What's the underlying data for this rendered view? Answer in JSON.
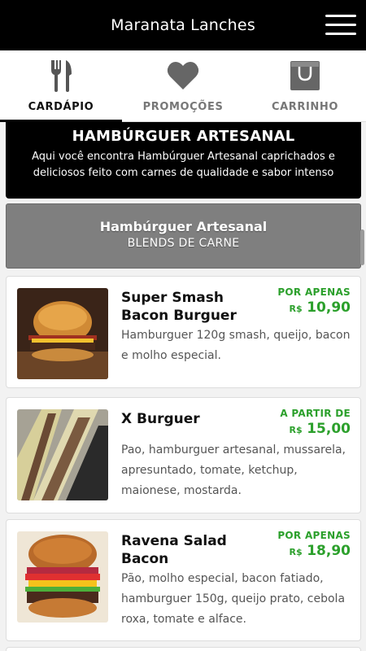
{
  "header": {
    "title": "Maranata Lanches",
    "menu_icon": "hamburger-menu-icon"
  },
  "tabs": [
    {
      "label": "CARDÁPIO",
      "icon": "fork-knife-icon",
      "active": true
    },
    {
      "label": "PROMOÇÕES",
      "icon": "heart-icon",
      "active": false
    },
    {
      "label": "CARRINHO",
      "icon": "shopping-bag-icon",
      "active": false
    }
  ],
  "category": {
    "title": "HAMBÚRGUER ARTESANAL",
    "description": "Aqui você encontra Hambúrguer Artesanal caprichados e deliciosos feito com carnes de qualidade e sabor intenso"
  },
  "section": {
    "title": "Hambúrguer Artesanal",
    "subtitle": "BLENDS DE CARNE"
  },
  "products": [
    {
      "name": "Super Smash Bacon Burguer",
      "price_prefix": "POR APENAS",
      "currency": "R$",
      "price": "10,90",
      "description": "Hamburguer 120g smash, queijo, bacon e molho especial."
    },
    {
      "name": "X Burguer",
      "price_prefix": "A PARTIR DE",
      "currency": "R$",
      "price": "15,00",
      "description": "Pao, hamburguer artesanal, mussarela, apresuntado, tomate, ketchup, maionese, mostarda."
    },
    {
      "name": "Ravena Salad Bacon",
      "price_prefix": "POR APENAS",
      "currency": "R$",
      "price": "18,90",
      "description": "Pão, molho especial, bacon fatiado, hamburguer 150g, queijo prato, cebola roxa, tomate e alface."
    }
  ],
  "colors": {
    "header_bg": "#000000",
    "price_green": "#2ca02c",
    "section_gray": "#7f7f7f"
  }
}
